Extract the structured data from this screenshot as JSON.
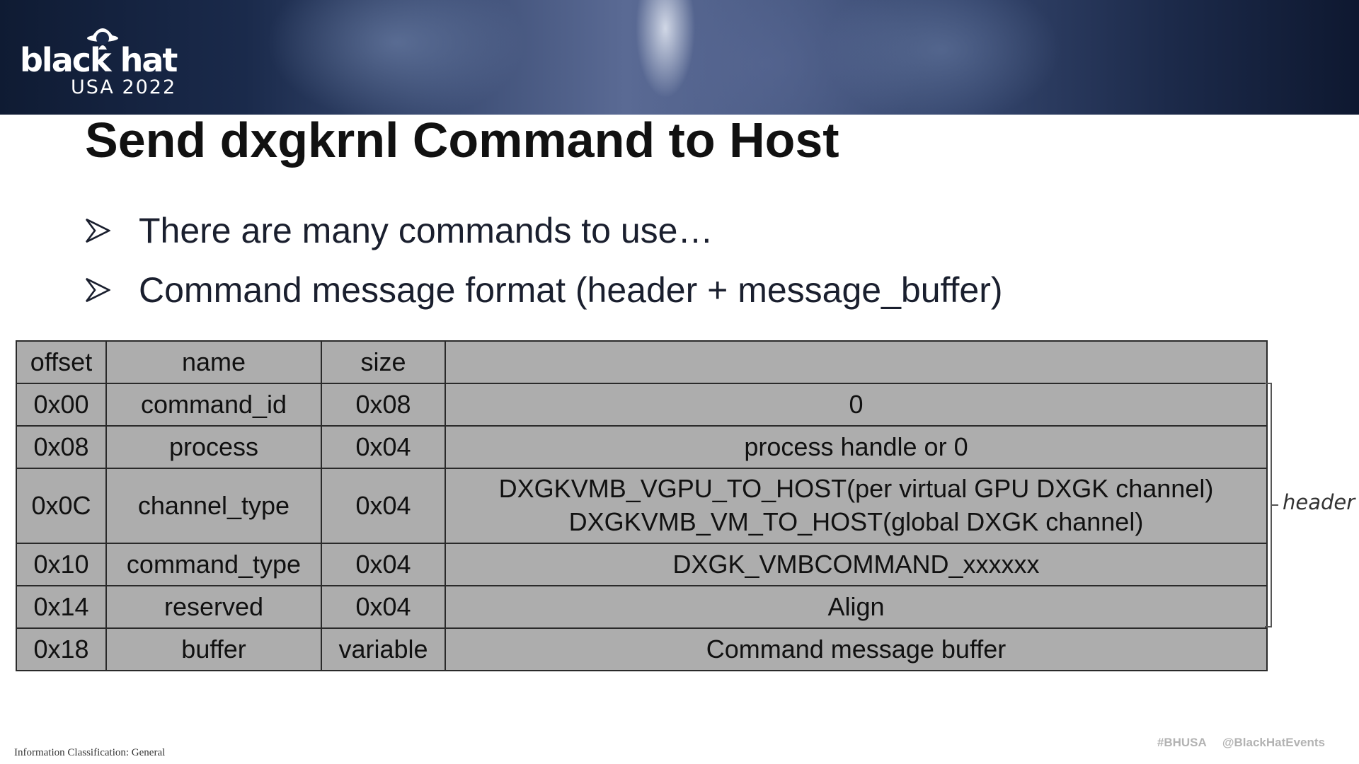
{
  "brand": {
    "wordmark": "black hat",
    "event": "USA 2022"
  },
  "slide": {
    "title": "Send dxgkrnl Command to Host",
    "bullets": [
      "There are many commands to use…",
      "Command message format (header + message_buffer)"
    ]
  },
  "table": {
    "columns": [
      "offset",
      "name",
      "size",
      ""
    ],
    "rows": [
      {
        "offset": "0x00",
        "name": "command_id",
        "size": "0x08",
        "desc": [
          "0"
        ]
      },
      {
        "offset": "0x08",
        "name": "process",
        "size": "0x04",
        "desc": [
          "process handle or 0"
        ]
      },
      {
        "offset": "0x0C",
        "name": "channel_type",
        "size": "0x04",
        "desc": [
          "DXGKVMB_VGPU_TO_HOST(per virtual GPU DXGK channel)",
          "DXGKVMB_VM_TO_HOST(global DXGK channel)"
        ]
      },
      {
        "offset": "0x10",
        "name": "command_type",
        "size": "0x04",
        "desc": [
          "DXGK_VMBCOMMAND_xxxxxx"
        ]
      },
      {
        "offset": "0x14",
        "name": "reserved",
        "size": "0x04",
        "desc": [
          "Align"
        ]
      },
      {
        "offset": "0x18",
        "name": "buffer",
        "size": "variable",
        "desc": [
          "Command message buffer"
        ]
      }
    ]
  },
  "annotation": {
    "header_label": "header"
  },
  "footer": {
    "classification": "Information Classification: General",
    "hashtag": "#BHUSA",
    "handle": "@BlackHatEvents"
  },
  "colors": {
    "table_fill": "#adadad",
    "table_border": "#2a2a2a",
    "title": "#111111",
    "footer_right": "#b3b3b3"
  }
}
